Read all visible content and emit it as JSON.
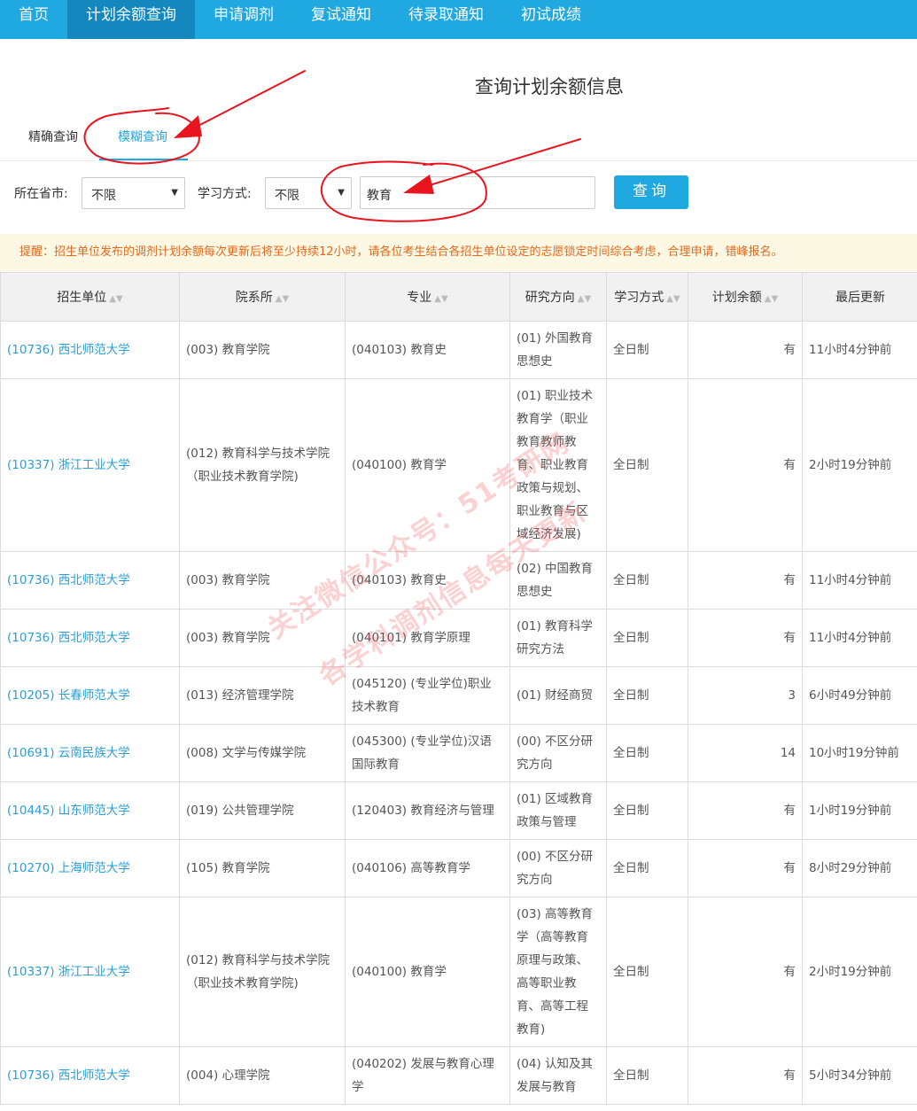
{
  "nav": {
    "items": [
      {
        "label": "首页",
        "active": false
      },
      {
        "label": "计划余额查询",
        "active": true
      },
      {
        "label": "申请调剂",
        "active": false
      },
      {
        "label": "复试通知",
        "active": false
      },
      {
        "label": "待录取通知",
        "active": false
      },
      {
        "label": "初试成绩",
        "active": false
      }
    ]
  },
  "page_title": "查询计划余额信息",
  "tabs": {
    "exact": "精确查询",
    "fuzzy": "模糊查询",
    "active": "fuzzy"
  },
  "filters": {
    "province_label": "所在省市:",
    "province_value": "不限",
    "study_label": "学习方式:",
    "study_value": "不限",
    "keyword_value": "教育",
    "query_button": "查询"
  },
  "notice": "提醒：招生单位发布的调剂计划余额每次更新后将至少持续12小时，请各位考生结合各招生单位设定的志愿锁定时间综合考虑，合理申请，错峰报名。",
  "table": {
    "headers": [
      "招生单位",
      "院系所",
      "专业",
      "研究方向",
      "学习方式",
      "计划余额",
      "最后更新"
    ],
    "rows": [
      {
        "unit": "(10736) 西北师范大学",
        "dept": "(003) 教育学院",
        "major": "(040103) 教育史",
        "direction": "(01) 外国教育思想史",
        "mode": "全日制",
        "remain": "有",
        "updated": "11小时4分钟前"
      },
      {
        "unit": "(10337) 浙江工业大学",
        "dept": "(012) 教育科学与技术学院（职业技术教育学院)",
        "major": "(040100) 教育学",
        "direction": "(01) 职业技术教育学（职业教育教师教育、职业教育政策与规划、职业教育与区域经济发展)",
        "mode": "全日制",
        "remain": "有",
        "updated": "2小时19分钟前"
      },
      {
        "unit": "(10736) 西北师范大学",
        "dept": "(003) 教育学院",
        "major": "(040103) 教育史",
        "direction": "(02) 中国教育思想史",
        "mode": "全日制",
        "remain": "有",
        "updated": "11小时4分钟前"
      },
      {
        "unit": "(10736) 西北师范大学",
        "dept": "(003) 教育学院",
        "major": "(040101) 教育学原理",
        "direction": "(01) 教育科学研究方法",
        "mode": "全日制",
        "remain": "有",
        "updated": "11小时4分钟前"
      },
      {
        "unit": "(10205) 长春师范大学",
        "dept": "(013) 经济管理学院",
        "major": "(045120) (专业学位)职业技术教育",
        "direction": "(01) 财经商贸",
        "mode": "全日制",
        "remain": "3",
        "updated": "6小时49分钟前"
      },
      {
        "unit": "(10691) 云南民族大学",
        "dept": "(008) 文学与传媒学院",
        "major": "(045300) (专业学位)汉语国际教育",
        "direction": "(00) 不区分研究方向",
        "mode": "全日制",
        "remain": "14",
        "updated": "10小时19分钟前"
      },
      {
        "unit": "(10445) 山东师范大学",
        "dept": "(019) 公共管理学院",
        "major": "(120403) 教育经济与管理",
        "direction": "(01) 区域教育政策与管理",
        "mode": "全日制",
        "remain": "有",
        "updated": "1小时19分钟前"
      },
      {
        "unit": "(10270) 上海师范大学",
        "dept": "(105) 教育学院",
        "major": "(040106) 高等教育学",
        "direction": "(00) 不区分研究方向",
        "mode": "全日制",
        "remain": "有",
        "updated": "8小时29分钟前"
      },
      {
        "unit": "(10337) 浙江工业大学",
        "dept": "(012) 教育科学与技术学院（职业技术教育学院)",
        "major": "(040100) 教育学",
        "direction": "(03) 高等教育学（高等教育原理与政策、高等职业教育、高等工程教育)",
        "mode": "全日制",
        "remain": "有",
        "updated": "2小时19分钟前"
      },
      {
        "unit": "(10736) 西北师范大学",
        "dept": "(004) 心理学院",
        "major": "(040202) 发展与教育心理学",
        "direction": "(04) 认知及其发展与教育",
        "mode": "全日制",
        "remain": "有",
        "updated": "5小时34分钟前"
      }
    ]
  },
  "watermark": {
    "line1": "关注微信公众号：51考研网",
    "line2": "各学科调剂信息每天更新"
  },
  "colors": {
    "accent": "#20a8e0",
    "nav_active": "#1487bf",
    "notice_bg": "#fcf8e3",
    "notice_text": "#e0691e",
    "annotation": "#e8141e"
  }
}
